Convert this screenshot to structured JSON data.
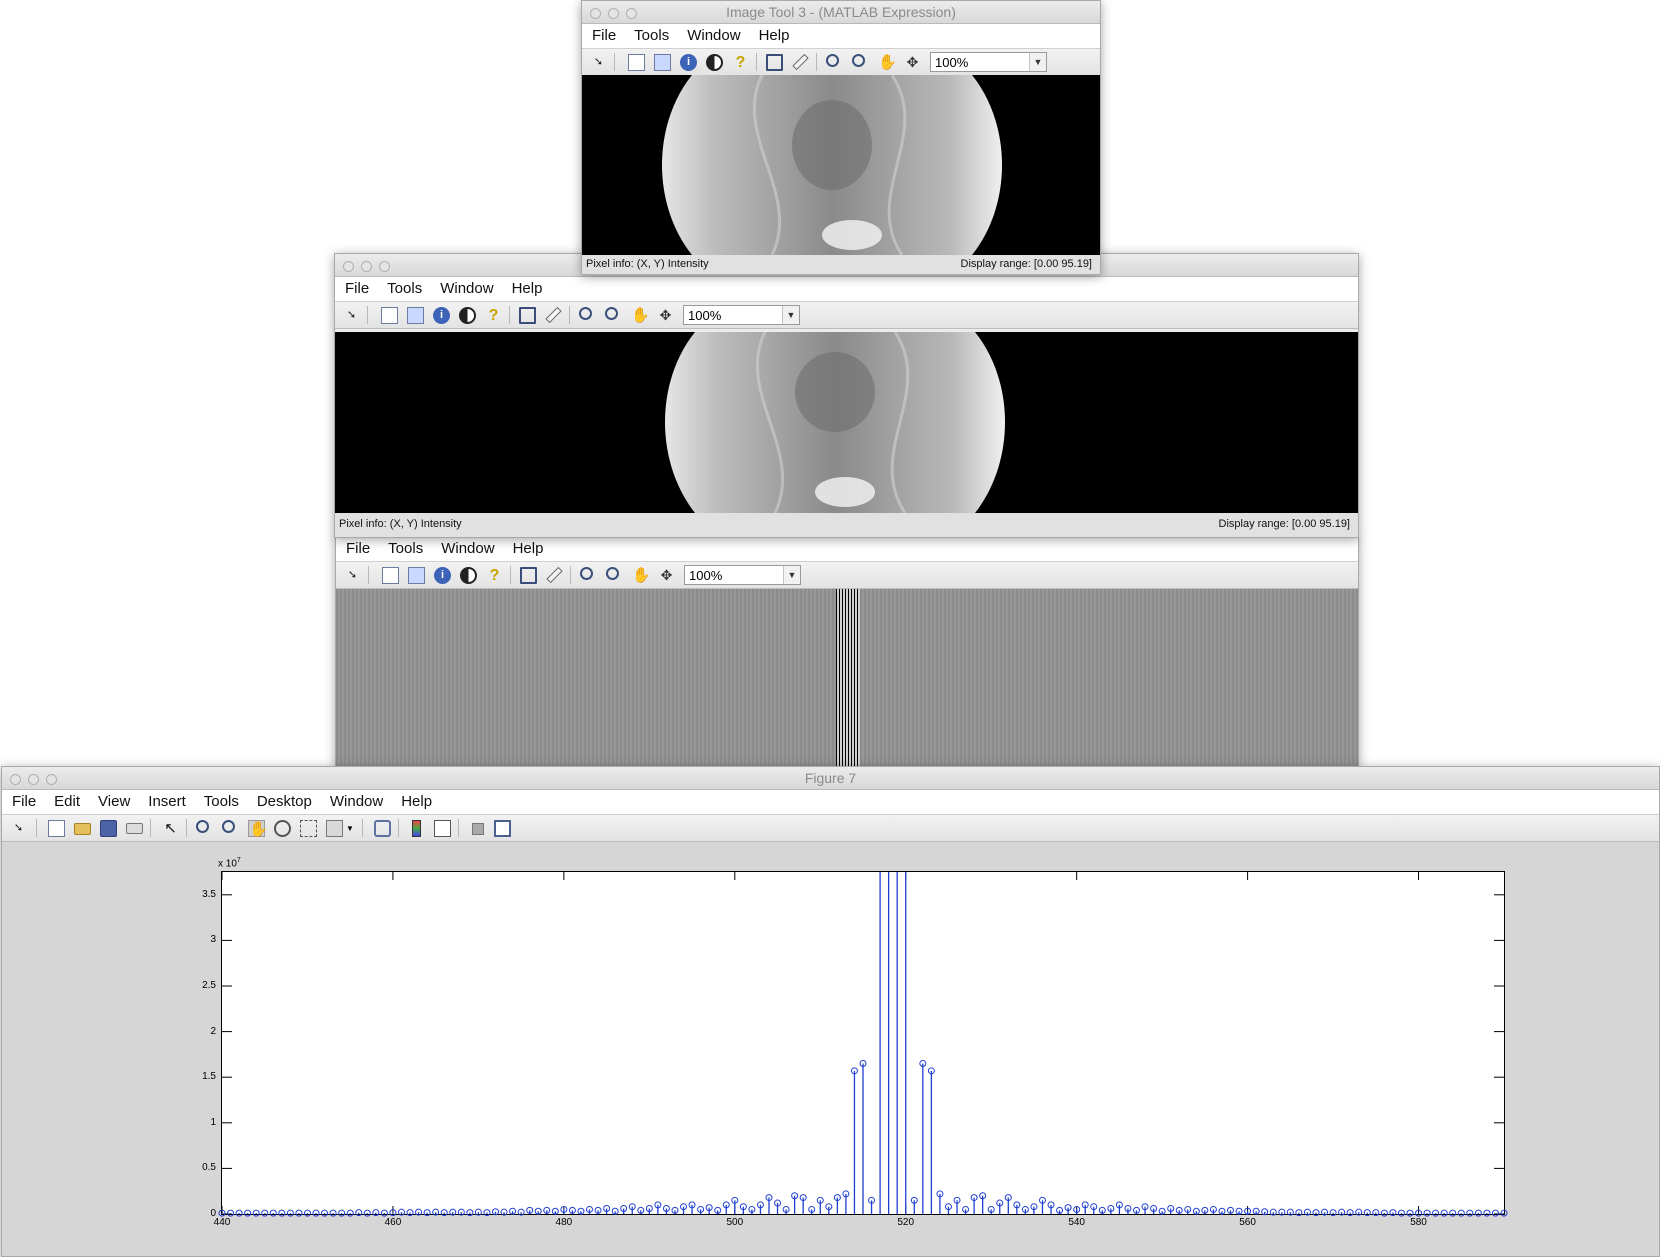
{
  "windows": {
    "imagetool3": {
      "title": "Image Tool 3 - (MATLAB Expression)",
      "menu": [
        "File",
        "Tools",
        "Window",
        "Help"
      ],
      "zoom": "100%",
      "status_left": "Pixel info: (X, Y)  Intensity",
      "status_right": "Display range: [0.00 95.19]"
    },
    "imagetool_b": {
      "title": "",
      "menu": [
        "File",
        "Tools",
        "Window",
        "Help"
      ],
      "zoom": "100%",
      "status_left": "Pixel info: (X, Y)  Intensity",
      "status_right": "Display range: [0.00 95.19]"
    },
    "imagetool_c": {
      "menu": [
        "File",
        "Tools",
        "Window",
        "Help"
      ],
      "zoom": "100%"
    },
    "figure7": {
      "title": "Figure 7",
      "menu": [
        "File",
        "Edit",
        "View",
        "Insert",
        "Tools",
        "Desktop",
        "Window",
        "Help"
      ]
    }
  },
  "icons": {
    "imagetool": [
      "arrow-icon",
      "document-icon",
      "image-info-icon",
      "info-icon",
      "contrast-icon",
      "help-icon",
      "crop-icon",
      "ruler-icon",
      "zoom-in-icon",
      "zoom-out-icon",
      "pan-icon",
      "overview-icon"
    ],
    "figure": [
      "arrow-icon",
      "new-figure-icon",
      "open-icon",
      "save-icon",
      "print-icon",
      "select-icon",
      "zoom-in-icon",
      "zoom-out-icon",
      "pan-icon",
      "rotate-icon",
      "data-cursor-icon",
      "brush-icon",
      "link-icon",
      "colorbar-icon",
      "legend-icon",
      "hide-tools-icon",
      "show-tools-icon"
    ]
  },
  "chart_data": {
    "type": "stem",
    "title": "",
    "xlabel": "",
    "ylabel": "",
    "exponent_label": "x 10",
    "exponent_power": "7",
    "xlim": [
      440,
      590
    ],
    "ylim": [
      0,
      3.75
    ],
    "xticks": [
      440,
      460,
      480,
      500,
      520,
      540,
      560,
      580
    ],
    "yticks": [
      "0",
      "0.5",
      "1",
      "1.5",
      "2",
      "2.5",
      "3",
      "3.5"
    ],
    "ytick_values": [
      0,
      0.5,
      1,
      1.5,
      2,
      2.5,
      3,
      3.5
    ],
    "marker": "circle",
    "color": "#1f3fd0",
    "points": [
      [
        440,
        0.01
      ],
      [
        441,
        0.01
      ],
      [
        442,
        0.01
      ],
      [
        443,
        0.01
      ],
      [
        444,
        0.01
      ],
      [
        445,
        0.01
      ],
      [
        446,
        0.01
      ],
      [
        447,
        0.01
      ],
      [
        448,
        0.01
      ],
      [
        449,
        0.01
      ],
      [
        450,
        0.01
      ],
      [
        451,
        0.01
      ],
      [
        452,
        0.01
      ],
      [
        453,
        0.01
      ],
      [
        454,
        0.01
      ],
      [
        455,
        0.01
      ],
      [
        456,
        0.015
      ],
      [
        457,
        0.01
      ],
      [
        458,
        0.015
      ],
      [
        459,
        0.01
      ],
      [
        460,
        0.015
      ],
      [
        461,
        0.02
      ],
      [
        462,
        0.015
      ],
      [
        463,
        0.02
      ],
      [
        464,
        0.015
      ],
      [
        465,
        0.02
      ],
      [
        466,
        0.015
      ],
      [
        467,
        0.02
      ],
      [
        468,
        0.02
      ],
      [
        469,
        0.015
      ],
      [
        470,
        0.02
      ],
      [
        471,
        0.015
      ],
      [
        472,
        0.025
      ],
      [
        473,
        0.02
      ],
      [
        474,
        0.03
      ],
      [
        475,
        0.02
      ],
      [
        476,
        0.04
      ],
      [
        477,
        0.03
      ],
      [
        478,
        0.04
      ],
      [
        479,
        0.03
      ],
      [
        480,
        0.05
      ],
      [
        481,
        0.04
      ],
      [
        482,
        0.03
      ],
      [
        483,
        0.05
      ],
      [
        484,
        0.04
      ],
      [
        485,
        0.06
      ],
      [
        486,
        0.03
      ],
      [
        487,
        0.06
      ],
      [
        488,
        0.08
      ],
      [
        489,
        0.04
      ],
      [
        490,
        0.06
      ],
      [
        491,
        0.1
      ],
      [
        492,
        0.06
      ],
      [
        493,
        0.04
      ],
      [
        494,
        0.08
      ],
      [
        495,
        0.1
      ],
      [
        496,
        0.05
      ],
      [
        497,
        0.07
      ],
      [
        498,
        0.04
      ],
      [
        499,
        0.1
      ],
      [
        500,
        0.15
      ],
      [
        501,
        0.08
      ],
      [
        502,
        0.05
      ],
      [
        503,
        0.1
      ],
      [
        504,
        0.18
      ],
      [
        505,
        0.12
      ],
      [
        506,
        0.05
      ],
      [
        507,
        0.2
      ],
      [
        508,
        0.18
      ],
      [
        509,
        0.05
      ],
      [
        510,
        0.15
      ],
      [
        511,
        0.08
      ],
      [
        512,
        0.18
      ],
      [
        513,
        0.22
      ],
      [
        514,
        1.57
      ],
      [
        515,
        1.65
      ],
      [
        516,
        0.15
      ],
      [
        517,
        3.75
      ],
      [
        518,
        3.75
      ],
      [
        519,
        3.75
      ],
      [
        520,
        3.75
      ],
      [
        521,
        0.15
      ],
      [
        522,
        1.65
      ],
      [
        523,
        1.57
      ],
      [
        524,
        0.22
      ],
      [
        525,
        0.08
      ],
      [
        526,
        0.15
      ],
      [
        527,
        0.05
      ],
      [
        528,
        0.18
      ],
      [
        529,
        0.2
      ],
      [
        530,
        0.05
      ],
      [
        531,
        0.12
      ],
      [
        532,
        0.18
      ],
      [
        533,
        0.1
      ],
      [
        534,
        0.05
      ],
      [
        535,
        0.08
      ],
      [
        536,
        0.15
      ],
      [
        537,
        0.1
      ],
      [
        538,
        0.04
      ],
      [
        539,
        0.07
      ],
      [
        540,
        0.05
      ],
      [
        541,
        0.1
      ],
      [
        542,
        0.08
      ],
      [
        543,
        0.04
      ],
      [
        544,
        0.06
      ],
      [
        545,
        0.1
      ],
      [
        546,
        0.06
      ],
      [
        547,
        0.04
      ],
      [
        548,
        0.08
      ],
      [
        549,
        0.06
      ],
      [
        550,
        0.03
      ],
      [
        551,
        0.06
      ],
      [
        552,
        0.04
      ],
      [
        553,
        0.05
      ],
      [
        554,
        0.03
      ],
      [
        555,
        0.04
      ],
      [
        556,
        0.05
      ],
      [
        557,
        0.03
      ],
      [
        558,
        0.04
      ],
      [
        559,
        0.03
      ],
      [
        560,
        0.03
      ],
      [
        561,
        0.03
      ],
      [
        562,
        0.025
      ],
      [
        563,
        0.02
      ],
      [
        564,
        0.02
      ],
      [
        565,
        0.02
      ],
      [
        566,
        0.015
      ],
      [
        567,
        0.02
      ],
      [
        568,
        0.015
      ],
      [
        569,
        0.02
      ],
      [
        570,
        0.015
      ],
      [
        571,
        0.02
      ],
      [
        572,
        0.015
      ],
      [
        573,
        0.02
      ],
      [
        574,
        0.015
      ],
      [
        575,
        0.015
      ],
      [
        576,
        0.01
      ],
      [
        577,
        0.015
      ],
      [
        578,
        0.01
      ],
      [
        579,
        0.01
      ],
      [
        580,
        0.01
      ],
      [
        581,
        0.01
      ],
      [
        582,
        0.01
      ],
      [
        583,
        0.01
      ],
      [
        584,
        0.01
      ],
      [
        585,
        0.01
      ],
      [
        586,
        0.01
      ],
      [
        587,
        0.01
      ],
      [
        588,
        0.01
      ],
      [
        589,
        0.01
      ],
      [
        590,
        0.01
      ]
    ]
  }
}
